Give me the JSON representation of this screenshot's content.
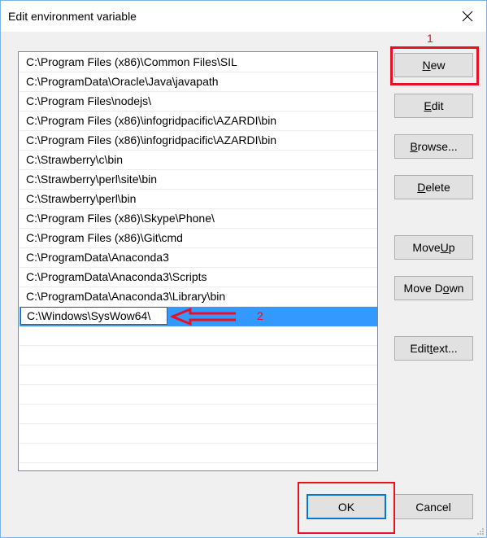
{
  "window": {
    "title": "Edit environment variable",
    "close_icon": "close-icon"
  },
  "path_list": {
    "items": [
      "C:\\Program Files (x86)\\Common Files\\SIL",
      "C:\\ProgramData\\Oracle\\Java\\javapath",
      "C:\\Program Files\\nodejs\\",
      "C:\\Program Files (x86)\\infogridpacific\\AZARDI\\bin",
      "C:\\Program Files (x86)\\infogridpacific\\AZARDI\\bin",
      "C:\\Strawberry\\c\\bin",
      "C:\\Strawberry\\perl\\site\\bin",
      "C:\\Strawberry\\perl\\bin",
      "C:\\Program Files (x86)\\Skype\\Phone\\",
      "C:\\Program Files (x86)\\Git\\cmd",
      "C:\\ProgramData\\Anaconda3",
      "C:\\ProgramData\\Anaconda3\\Scripts",
      "C:\\ProgramData\\Anaconda3\\Library\\bin"
    ],
    "editing_value": "C:\\Windows\\SysWow64\\",
    "selected_index": 13,
    "empty_rows": 8
  },
  "buttons": {
    "new": {
      "pre": "",
      "ul": "N",
      "post": "ew"
    },
    "edit": {
      "pre": "",
      "ul": "E",
      "post": "dit"
    },
    "browse": {
      "pre": "",
      "ul": "B",
      "post": "rowse..."
    },
    "delete": {
      "pre": "",
      "ul": "D",
      "post": "elete"
    },
    "move_up": {
      "pre": "Move ",
      "ul": "U",
      "post": "p"
    },
    "move_down": {
      "pre": "Move D",
      "ul": "o",
      "post": "wn"
    },
    "edit_text": {
      "pre": "Edit ",
      "ul": "t",
      "post": "ext..."
    },
    "ok": "OK",
    "cancel": "Cancel"
  },
  "annotations": {
    "step1": "1",
    "step2": "2",
    "color": "#e81123"
  }
}
